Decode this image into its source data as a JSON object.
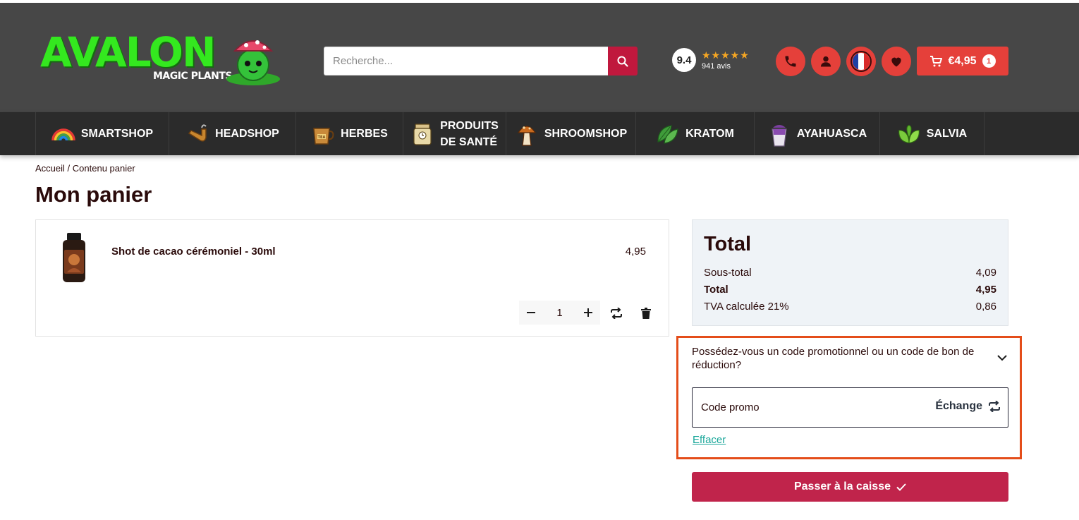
{
  "colors": {
    "header_bg": "#474747",
    "nav_bg": "#2b2b2b",
    "accent_red": "#e5403a",
    "primary_crimson": "#c0244b",
    "logo_green": "#34e81f",
    "highlight_orange": "#e44d1a",
    "link_teal": "#1aa79a"
  },
  "header": {
    "logo": {
      "title": "AVALON",
      "subtitle": "MAGIC PLANTS"
    },
    "search": {
      "placeholder": "Recherche...",
      "icon": "search-icon"
    },
    "rating": {
      "score": "9.4",
      "stars": "★★★★★",
      "reviews": "941 avis"
    },
    "icons": [
      "phone-icon",
      "user-icon",
      "france-flag-icon",
      "heart-icon"
    ],
    "cart": {
      "amount": "€4,95",
      "count": "1",
      "icon": "cart-icon"
    }
  },
  "nav": {
    "items": [
      {
        "label": "SMARTSHOP",
        "icon": "rainbow-icon"
      },
      {
        "label": "HEADSHOP",
        "icon": "pipe-icon"
      },
      {
        "label": "HERBES",
        "icon": "tea-cup-icon"
      },
      {
        "label_line1": "PRODUITS",
        "label_line2": "DE SANTÉ",
        "icon": "supplement-jar-icon"
      },
      {
        "label": "SHROOMSHOP",
        "icon": "mushroom-icon"
      },
      {
        "label": "KRATOM",
        "icon": "leaf-icon"
      },
      {
        "label": "AYAHUASCA",
        "icon": "drink-cup-icon"
      },
      {
        "label": "SALVIA",
        "icon": "salvia-leaves-icon"
      }
    ]
  },
  "breadcrumb": {
    "home": "Accueil",
    "separator": "/",
    "current": "Contenu panier"
  },
  "page": {
    "title": "Mon panier"
  },
  "cart": {
    "items": [
      {
        "name": "Shot de cacao cérémoniel - 30ml",
        "price": "4,95",
        "quantity": "1"
      }
    ]
  },
  "summary": {
    "title": "Total",
    "rows": [
      {
        "label": "Sous-total",
        "value": "4,09"
      },
      {
        "label": "Total",
        "value": "4,95"
      },
      {
        "label": "TVA calculée 21%",
        "value": "0,86"
      }
    ]
  },
  "promo": {
    "question": "Possédez-vous un code promotionnel ou un code de bon de réduction?",
    "placeholder": "Code promo",
    "exchange_label": "Échange",
    "clear_label": "Effacer"
  },
  "checkout": {
    "label": "Passer à la caisse"
  }
}
